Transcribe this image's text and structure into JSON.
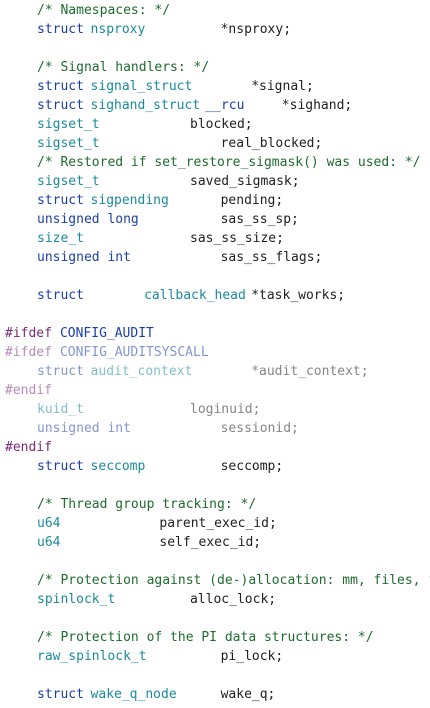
{
  "lines": [
    [
      {
        "t": "/* Namespaces: */",
        "c": "comment",
        "col": 0
      }
    ],
    [
      {
        "t": "struct",
        "c": "kw",
        "col": 0
      },
      {
        "t": "nsproxy",
        "c": "type",
        "col": 7
      },
      {
        "t": "*nsproxy;",
        "c": "text",
        "col": 24
      }
    ],
    [],
    [
      {
        "t": "/* Signal handlers: */",
        "c": "comment",
        "col": 0
      }
    ],
    [
      {
        "t": "struct",
        "c": "kw",
        "col": 0
      },
      {
        "t": "signal_struct",
        "c": "type",
        "col": 7
      },
      {
        "t": "*signal;",
        "c": "text",
        "col": 28
      }
    ],
    [
      {
        "t": "struct",
        "c": "kw",
        "col": 0
      },
      {
        "t": "sighand_struct",
        "c": "type",
        "col": 7
      },
      {
        "t": "__rcu",
        "c": "kw",
        "col": 22
      },
      {
        "t": "*sighand;",
        "c": "text",
        "col": 32
      }
    ],
    [
      {
        "t": "sigset_t",
        "c": "type",
        "col": 0
      },
      {
        "t": "blocked;",
        "c": "text",
        "col": 20
      }
    ],
    [
      {
        "t": "sigset_t",
        "c": "type",
        "col": 0
      },
      {
        "t": "real_blocked;",
        "c": "text",
        "col": 24
      }
    ],
    [
      {
        "t": "/* Restored if set_restore_sigmask() was used: */",
        "c": "comment",
        "col": 0
      }
    ],
    [
      {
        "t": "sigset_t",
        "c": "type",
        "col": 0
      },
      {
        "t": "saved_sigmask;",
        "c": "text",
        "col": 20
      }
    ],
    [
      {
        "t": "struct",
        "c": "kw",
        "col": 0
      },
      {
        "t": "sigpending",
        "c": "type",
        "col": 7
      },
      {
        "t": "pending;",
        "c": "text",
        "col": 24
      }
    ],
    [
      {
        "t": "unsigned long",
        "c": "kw",
        "col": 0
      },
      {
        "t": "sas_ss_sp;",
        "c": "text",
        "col": 24
      }
    ],
    [
      {
        "t": "size_t",
        "c": "type",
        "col": 0
      },
      {
        "t": "sas_ss_size;",
        "c": "text",
        "col": 20
      }
    ],
    [
      {
        "t": "unsigned int",
        "c": "kw",
        "col": 0
      },
      {
        "t": "sas_ss_flags;",
        "c": "text",
        "col": 24
      }
    ],
    [],
    [
      {
        "t": "struct",
        "c": "kw",
        "col": 0
      },
      {
        "t": "callback_head",
        "c": "type",
        "col": 14
      },
      {
        "t": "*task_works;",
        "c": "text",
        "col": 28
      }
    ],
    [],
    [
      {
        "t": "#ifdef",
        "c": "pp",
        "col": -4
      },
      {
        "t": "CONFIG_AUDIT",
        "c": "ppname",
        "col": 3
      }
    ],
    [
      {
        "t": "#ifdef",
        "c": "pp",
        "col": -4,
        "dim": true
      },
      {
        "t": "CONFIG_AUDITSYSCALL",
        "c": "ppname",
        "col": 3,
        "dim": true
      }
    ],
    [
      {
        "t": "struct",
        "c": "kw",
        "col": 0,
        "dim": true
      },
      {
        "t": "audit_context",
        "c": "type",
        "col": 7,
        "dim": true
      },
      {
        "t": "*audit_context;",
        "c": "text",
        "col": 28,
        "dim": true
      }
    ],
    [
      {
        "t": "#endif",
        "c": "pp",
        "col": -4,
        "dim": true
      }
    ],
    [
      {
        "t": "kuid_t",
        "c": "type",
        "col": 0,
        "dim": true
      },
      {
        "t": "loginuid;",
        "c": "text",
        "col": 20,
        "dim": true
      }
    ],
    [
      {
        "t": "unsigned int",
        "c": "kw",
        "col": 0,
        "dim": true
      },
      {
        "t": "sessionid;",
        "c": "text",
        "col": 24,
        "dim": true
      }
    ],
    [
      {
        "t": "#endif",
        "c": "pp",
        "col": -4
      }
    ],
    [
      {
        "t": "struct",
        "c": "kw",
        "col": 0
      },
      {
        "t": "seccomp",
        "c": "type",
        "col": 7
      },
      {
        "t": "seccomp;",
        "c": "text",
        "col": 24
      }
    ],
    [],
    [
      {
        "t": "/* Thread group tracking: */",
        "c": "comment",
        "col": 0
      }
    ],
    [
      {
        "t": "u64",
        "c": "type",
        "col": 0
      },
      {
        "t": "parent_exec_id;",
        "c": "text",
        "col": 16
      }
    ],
    [
      {
        "t": "u64",
        "c": "type",
        "col": 0
      },
      {
        "t": "self_exec_id;",
        "c": "text",
        "col": 16
      }
    ],
    [],
    [
      {
        "t": "/* Protection against (de-)allocation: mm, files, f",
        "c": "comment",
        "col": 0
      }
    ],
    [
      {
        "t": "spinlock_t",
        "c": "type",
        "col": 0
      },
      {
        "t": "alloc_lock;",
        "c": "text",
        "col": 20
      }
    ],
    [],
    [
      {
        "t": "/* Protection of the PI data structures: */",
        "c": "comment",
        "col": 0
      }
    ],
    [
      {
        "t": "raw_spinlock_t",
        "c": "type",
        "col": 0
      },
      {
        "t": "pi_lock;",
        "c": "text",
        "col": 24
      }
    ],
    [],
    [
      {
        "t": "struct",
        "c": "kw",
        "col": 0
      },
      {
        "t": "wake_q_node",
        "c": "type",
        "col": 7
      },
      {
        "t": "wake_q;",
        "c": "text",
        "col": 24
      }
    ]
  ]
}
